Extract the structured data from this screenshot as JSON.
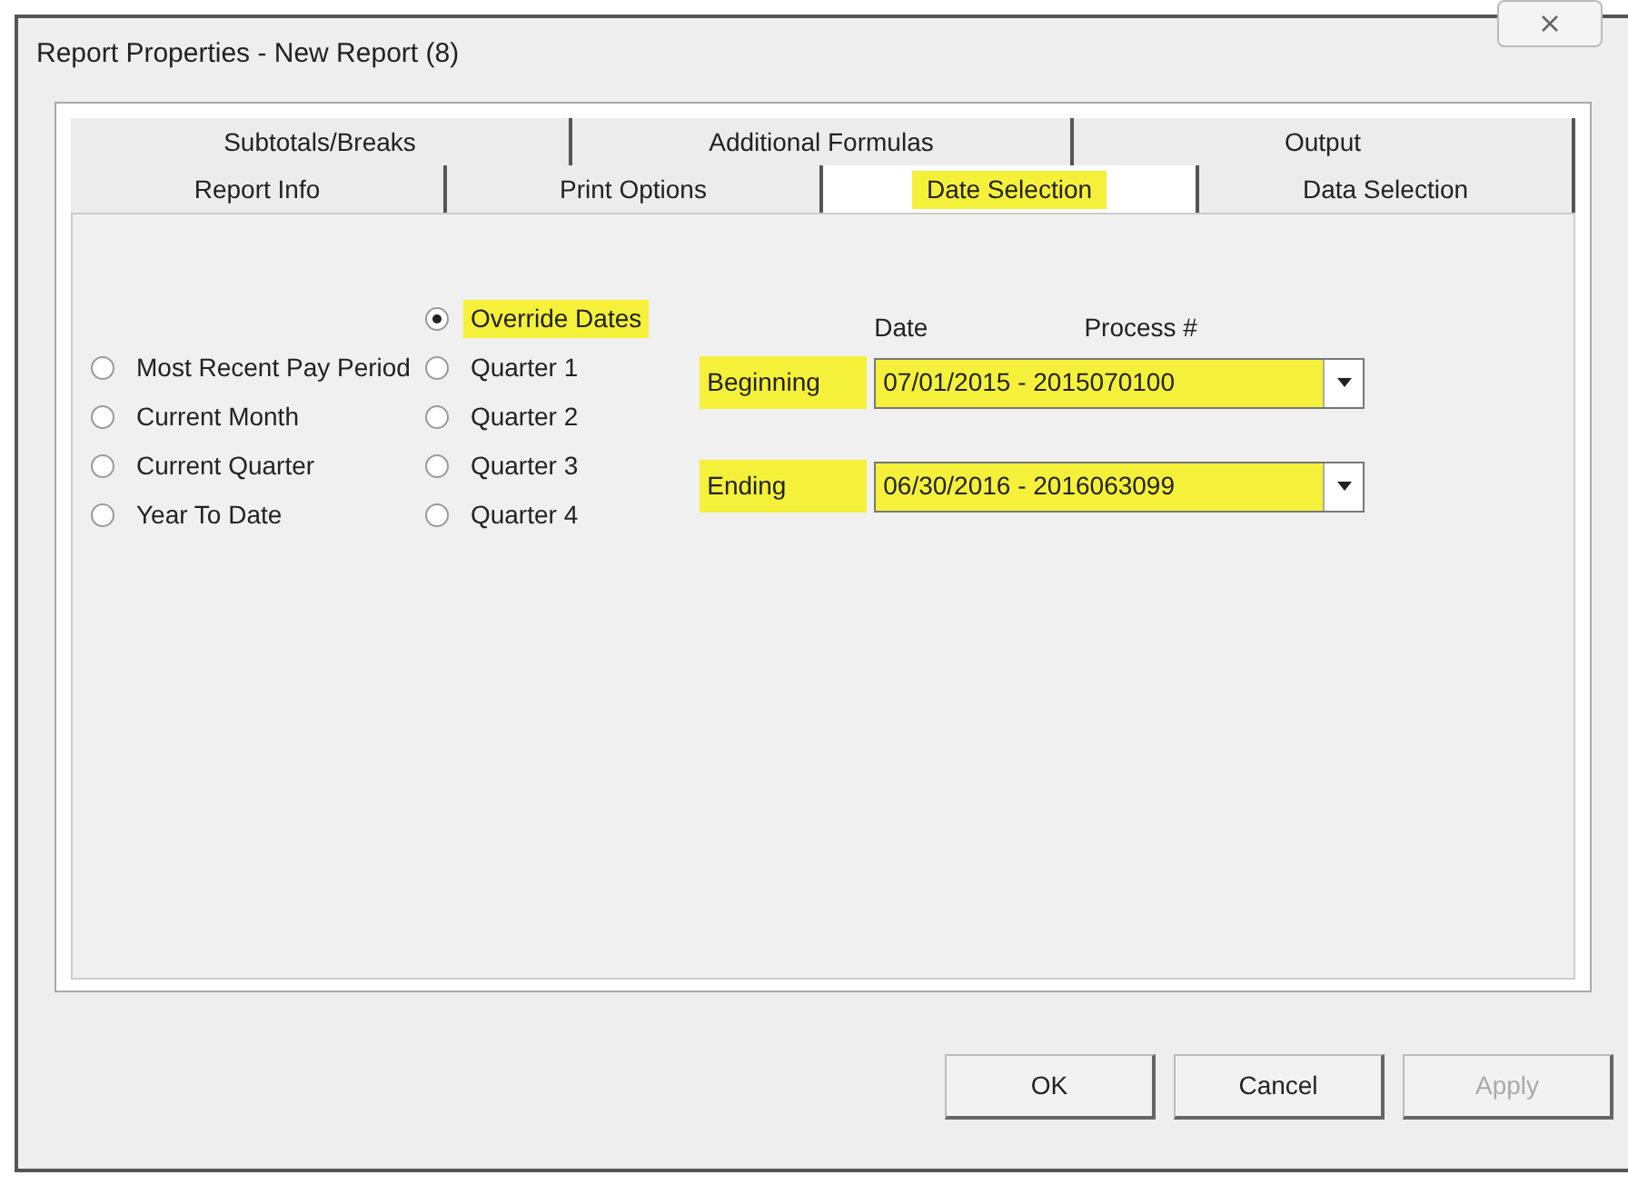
{
  "window": {
    "title": "Report Properties - New Report (8)"
  },
  "tab_rows": [
    {
      "tabs": [
        {
          "label": "Subtotals/Breaks",
          "selected": false,
          "highlighted": false
        },
        {
          "label": "Additional Formulas",
          "selected": false,
          "highlighted": false
        },
        {
          "label": "Output",
          "selected": false,
          "highlighted": false
        }
      ]
    },
    {
      "tabs": [
        {
          "label": "Report Info",
          "selected": false,
          "highlighted": false
        },
        {
          "label": "Print Options",
          "selected": false,
          "highlighted": false
        },
        {
          "label": "Date Selection",
          "selected": true,
          "highlighted": true
        },
        {
          "label": "Data Selection",
          "selected": false,
          "highlighted": false
        }
      ]
    }
  ],
  "date_options": [
    [
      {
        "label": "Most Recent Pay Period",
        "selected": false,
        "highlighted": false
      },
      {
        "label": "Current Month",
        "selected": false,
        "highlighted": false
      },
      {
        "label": "Current Quarter",
        "selected": false,
        "highlighted": false
      },
      {
        "label": "Year To Date",
        "selected": false,
        "highlighted": false
      }
    ],
    [
      {
        "label": "Override Dates",
        "selected": true,
        "highlighted": true
      },
      {
        "label": "Quarter 1",
        "selected": false,
        "highlighted": false
      },
      {
        "label": "Quarter 2",
        "selected": false,
        "highlighted": false
      },
      {
        "label": "Quarter 3",
        "selected": false,
        "highlighted": false
      },
      {
        "label": "Quarter 4",
        "selected": false,
        "highlighted": false
      }
    ]
  ],
  "range": {
    "columns": [
      "Date",
      "Process #"
    ],
    "rows": [
      {
        "label": "Beginning",
        "value": "07/01/2015 - 2015070100",
        "highlighted": true
      },
      {
        "label": "Ending",
        "value": "06/30/2016 - 2016063099",
        "highlighted": true
      }
    ]
  },
  "buttons": [
    {
      "label": "OK",
      "disabled": false
    },
    {
      "label": "Cancel",
      "disabled": false
    },
    {
      "label": "Apply",
      "disabled": true
    }
  ]
}
